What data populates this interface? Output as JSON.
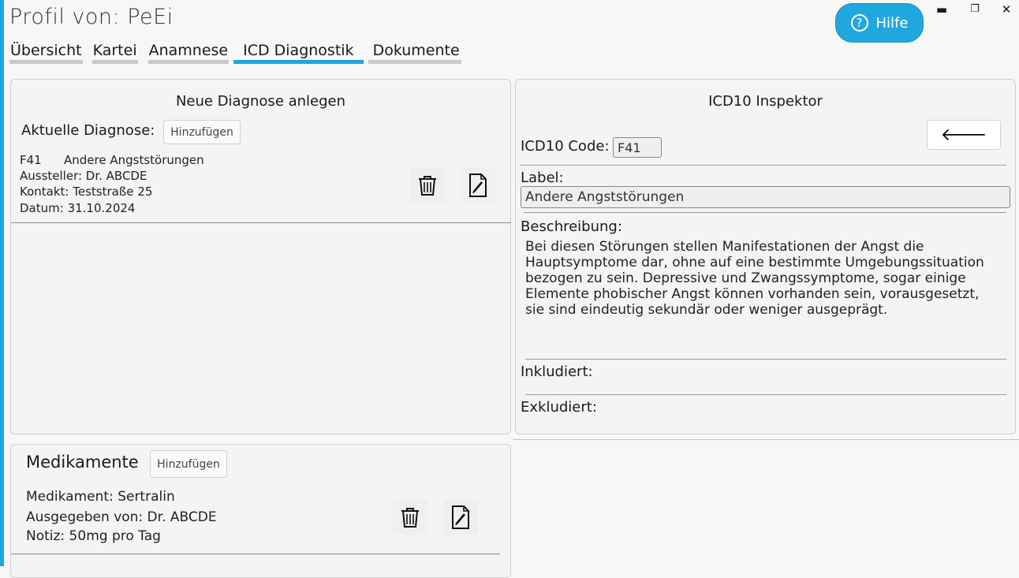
{
  "window": {
    "title": "Profil von: PeEi",
    "minimize": "▬",
    "maximize": "❐",
    "close": "✕"
  },
  "help": {
    "label": "Hilfe",
    "icon": "?"
  },
  "tabs": [
    {
      "label": "Übersicht"
    },
    {
      "label": "Kartei"
    },
    {
      "label": "Anamnese"
    },
    {
      "label": "ICD Diagnostik"
    },
    {
      "label": "Dokumente"
    }
  ],
  "diagnose_panel": {
    "title": "Neue Diagnose anlegen",
    "current_label": "Aktuelle Diagnose:",
    "add_button": "Hinzufügen",
    "entry": {
      "code": "F41",
      "name": "Andere Angststörungen",
      "issuer": "Aussteller: Dr. ABCDE",
      "contact": "Kontakt: Teststraße 25",
      "date": "Datum: 31.10.2024"
    }
  },
  "inspector": {
    "title": "ICD10 Inspektor",
    "back_icon": "🡐",
    "code_label": "ICD10 Code:",
    "code_value": "F41",
    "label_label": "Label:",
    "label_value": "Andere Angststörungen",
    "description_label": "Beschreibung:",
    "description": "Bei diesen Störungen stellen Manifestationen der Angst die Hauptsymptome dar, ohne auf eine bestimmte Umgebungssituation bezogen zu sein. Depressive und Zwangssymptome, sogar einige Elemente phobischer Angst können vorhanden sein, vorausgesetzt, sie sind eindeutig sekundär oder weniger ausgeprägt.",
    "included_label": "Inkludiert:",
    "excluded_label": "Exkludiert:"
  },
  "medication_panel": {
    "title": "Medikamente",
    "add_button": "Hinzufügen",
    "entry": {
      "medication": "Medikament:  Sertralin",
      "issued_by": "Ausgegeben von: Dr. ABCDE",
      "note": "Notiz: 50mg pro Tag"
    }
  }
}
